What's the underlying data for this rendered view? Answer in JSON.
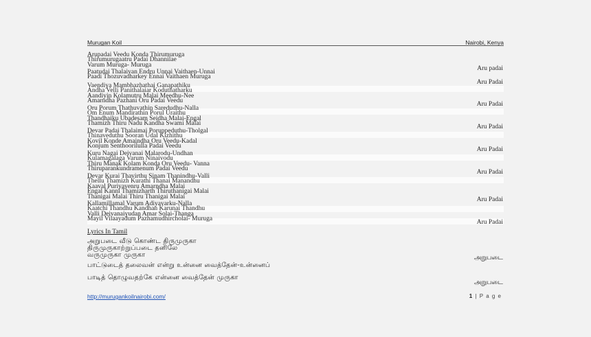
{
  "header": {
    "left": "Murugan Koil",
    "right": "Nairobi, Kenya"
  },
  "verses": [
    {
      "lines": [
        "Arupadai Veedu Konda Thirumuruga",
        "Thirumurugaatru Padai Dhannilae",
        "Varum Muruga- Muruga"
      ],
      "ref": "Aru padai"
    },
    {
      "lines": [
        "Paatudai Thalaivan Endru Unnai Vaithaen-Unnai",
        "Paadi Thozuvadharkey Ennai Vaithaen Muruga"
      ],
      "ref": "Aru Padai"
    },
    {
      "lines": [
        "Vaendiya Mambhazhathai Ganapathiku",
        "Andha Velli Panithalaiar Koduthatharku",
        "Aandiyin Kolamutru Malai Meedhu-Nee",
        "Amarndha Pazhani Oru Padai Veedu"
      ],
      "ref": "Aru Padai"
    },
    {
      "lines": [
        "Oru Porum Thathuvathin Saredudhu-Nalla",
        "Om Enum Mandirathin Porul Uraithu",
        "Thandhaiku Ubadesam Seidha Malai-Engal",
        "Thamizh Thiru Nadu Kandha Swami Malai"
      ],
      "ref": "Aru Padai"
    },
    {
      "lines": [
        "Devar Padai Thalaimai Poruppeduthu-Tholgal",
        "Thinaveduthu Sooran Udal Kizhithu",
        "Kovil Konde Amaindha Oru Veedu-Kadal",
        "Konjum Senthoorilulla Padai Veedu"
      ],
      "ref": "Aru Padai"
    },
    {
      "lines": [
        "Kuru Nagai Deivanai Malarodu-Undhan",
        "Kulamagalaga Varum Ninaivodu",
        "Thiru Manak Kolam Konda Oru Veedu- Vanna",
        "Thiruparankundramenum Padai Veedu"
      ],
      "ref": "Aru Padai"
    },
    {
      "lines": [
        "Devar Kurai Thavirthu  Sinam Thanindhu-Valli",
        "Thellu Thamizh Kurathi Thanai Manandhu",
        "Kaaval Puriyavenru Amarndha Malai",
        "Engal Kanni Thamizharth Thiruthanigai Malai",
        "Thanigai Malai Thiru Thanigai Malai"
      ],
      "ref": "Aru Padai"
    },
    {
      "lines": [
        "Kallamillamal Varum Adiyavarku-Nalla",
        "Kaatchi Thandhu Kandhan Karunai Thandhu",
        "Valli Deivanaiyudan Amar Solai-Thanga",
        "Mayil Vilaayadum Pazhamudhircholai- Muruga"
      ],
      "ref": "Aru Padai"
    }
  ],
  "tamil_heading": "Lyrics In Tamil",
  "tamil_blocks": [
    {
      "lines": [
        "அறுபடை வீடு கொண்ட திருமுருகா",
        "திருமுருகாற்றுப்படை தனிலே",
        "வருமுருகா முருகா"
      ],
      "ref": "அறுபடை"
    },
    {
      "lines": [
        "பாட்டுடைத் தலைவன் என்று உன்னை வைத்தேன்-உன்னைப்"
      ],
      "ref": ""
    },
    {
      "lines": [
        "பாடித் தொழுவதற்கே என்னை வைத்தேன் முருகா"
      ],
      "ref": "அறுபடை"
    }
  ],
  "footer": {
    "link": "http://murugankoilnairobi.com/",
    "page_number": "1",
    "page_label": "| P a g e"
  }
}
